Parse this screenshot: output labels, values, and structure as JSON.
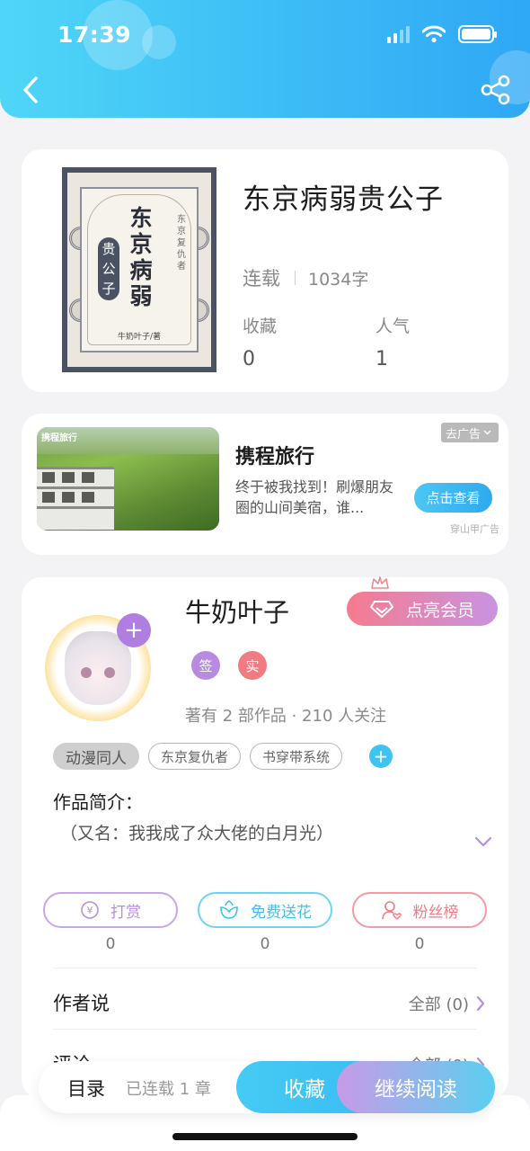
{
  "status": {
    "time": "17:39"
  },
  "book": {
    "title": "东京病弱贵公子",
    "status": "连载",
    "word_count": "1034字",
    "favorites_label": "收藏",
    "favorites_value": "0",
    "popularity_label": "人气",
    "popularity_value": "1",
    "cover": {
      "title_chars": [
        "东",
        "京",
        "病",
        "弱"
      ],
      "seal_chars": [
        "贵",
        "公",
        "子"
      ],
      "subtitle_chars": [
        "东",
        "京",
        "复",
        "仇",
        "者"
      ],
      "author_line": "牛奶叶子/著"
    }
  },
  "ad": {
    "image_logo": "携程旅行",
    "title": "携程旅行",
    "description": "终于被我找到！刷爆朋友圈的山间美宿，谁...",
    "cta": "点击查看",
    "close_tag": "去广告",
    "source": "穿山甲广告"
  },
  "author": {
    "name": "牛奶叶子",
    "vip_button": "点亮会员",
    "badge_sign": "签",
    "badge_real": "实",
    "stats": "著有 2 部作品 · 210 人关注",
    "tags": [
      "动漫同人",
      "东京复仇者",
      "书穿带系统"
    ],
    "intro_label": "作品简介：",
    "intro_text": "（又名：我我成了众大佬的白月光）",
    "actions": [
      {
        "label": "打赏",
        "count": "0",
        "color": "#b58ee0"
      },
      {
        "label": "免费送花",
        "count": "0",
        "color": "#3cc2ef"
      },
      {
        "label": "粉丝榜",
        "count": "0",
        "color": "#f07b85"
      }
    ],
    "author_says_label": "作者说",
    "author_says_more": "全部 (0)",
    "comments_label": "评论",
    "comments_more": "全部 (0)"
  },
  "bottom": {
    "toc": "目录",
    "chapters": "已连载 1 章",
    "favorite_button": "收藏",
    "read_button": "继续阅读"
  },
  "colors": {
    "header_start": "#4fd6f7",
    "header_end": "#2fa8f5",
    "accent_purple": "#b07ee0",
    "vip_pink": "#f57b8f"
  }
}
